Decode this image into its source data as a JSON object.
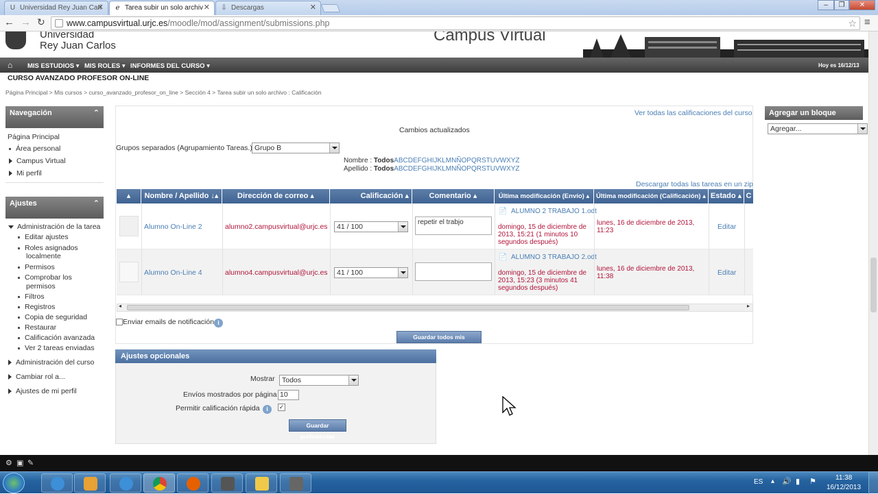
{
  "browser": {
    "tabs": [
      {
        "title": "Universidad Rey Juan Carl",
        "icon": "U"
      },
      {
        "title": "Tarea subir un solo archiv",
        "icon": "ℯ"
      },
      {
        "title": "Descargas",
        "icon": "⇩"
      }
    ],
    "url_host": "www.campusvirtual.urjc.es",
    "url_path": "/moodle/mod/assignment/submissions.php"
  },
  "banner": {
    "uni_line1": "Universidad",
    "uni_line2": "Rey Juan Carlos",
    "campus": "Campus Virtual"
  },
  "navbar": {
    "items": [
      "MIS ESTUDIOS",
      "MIS ROLES",
      "INFORMES DEL CURSO"
    ],
    "date": "Hoy es 16/12/13"
  },
  "course_title": "CURSO AVANZADO PROFESOR ON-LINE",
  "breadcrumb": [
    "Página Principal",
    "Mis cursos",
    "curso_avanzado_profesor_on_line",
    "Sección 4",
    "Tarea subir un solo archivo : Calificación"
  ],
  "nav_block": {
    "title": "Navegación",
    "items": [
      "Página Principal",
      "Área personal",
      "Campus Virtual",
      "Mi perfil"
    ]
  },
  "settings_block": {
    "title": "Ajustes",
    "section": "Administración de la tarea",
    "items": [
      "Editar ajustes",
      "Roles asignados",
      "localmente",
      "Permisos",
      "Comprobar los",
      "permisos",
      "Filtros",
      "Registros",
      "Copia de seguridad",
      "Restaurar",
      "Calificación avanzada",
      "Ver 2 tareas enviadas"
    ],
    "extra": [
      "Administración del curso",
      "Cambiar rol a...",
      "Ajustes de mi perfil"
    ]
  },
  "add_block": {
    "title": "Agregar un bloque",
    "placeholder": "Agregar..."
  },
  "main": {
    "view_all": "Ver todas las calificaciones del curso",
    "status": "Cambios actualizados",
    "groups_label": "Grupos separados (Agrupamiento Tareas.)",
    "group_value": "Grupo B",
    "name_label": "Nombre :",
    "surname_label": "Apellido :",
    "all": "Todos",
    "letters": "ABCDEFGHIJKLMNÑOPQRSTUVWXYZ",
    "download_all": "Descargar todas las tareas en un zip",
    "columns": [
      "",
      "Nombre / Apellido",
      "Dirección de correo",
      "Calificación",
      "Comentario",
      "Última modificación (Envío)",
      "Última modificación (Calificación)",
      "Estado",
      "C"
    ],
    "rows": [
      {
        "name": "Alumno On-Line 2",
        "email": "alumno2.campusvirtual@urjc.es",
        "grade": "41 / 100",
        "comment": "repetir el trabjo",
        "file": "ALUMNO 2 TRABAJO 1.odt",
        "sub1": "domingo, 15 de diciembre de",
        "sub2": "2013, 15:21 (1 minutos 10",
        "sub3": "segundos después)",
        "graded1": "lunes, 16 de diciembre de 2013,",
        "graded2": "11:23",
        "action": "Editar"
      },
      {
        "name": "Alumno On-Line 4",
        "email": "alumno4.campusvirtual@urjc.es",
        "grade": "41 / 100",
        "comment": "",
        "file": "ALUMNO 3 TRABAJO 2.odt",
        "sub1": "domingo, 15 de diciembre de",
        "sub2": "2013, 15:23 (3 minutos 41",
        "sub3": "segundos después)",
        "graded1": "lunes, 16 de diciembre de 2013,",
        "graded2": "11:38",
        "action": "Editar"
      }
    ],
    "notify_label": "Enviar emails de notificación",
    "save_comments": "Guardar todos mis comentarios"
  },
  "optional": {
    "title": "Ajustes opcionales",
    "show_label": "Mostrar",
    "show_value": "Todos",
    "perpage_label": "Envíos mostrados por página",
    "perpage_value": "10",
    "quick_label": "Permitir calificación rápida",
    "save_prefs": "Guardar preferencias"
  },
  "taskbar": {
    "lang": "ES",
    "time": "11:38",
    "date": "16/12/2013"
  }
}
